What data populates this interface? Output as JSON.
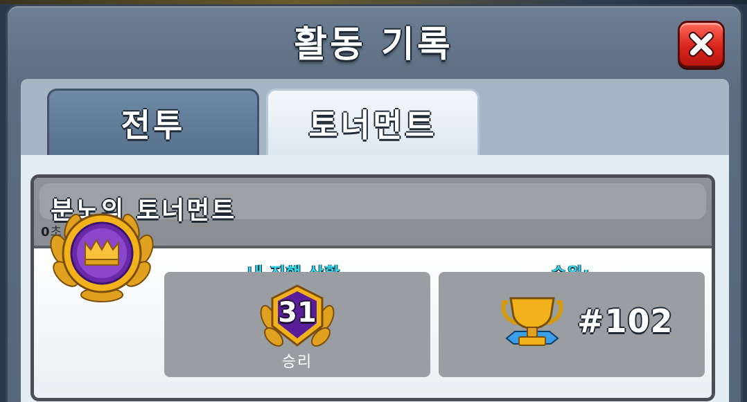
{
  "window": {
    "title": "활동 기록"
  },
  "tabs": [
    {
      "label": "전투",
      "active": false
    },
    {
      "label": "토너먼트",
      "active": true
    }
  ],
  "tournament": {
    "name": "분노의 토너먼트",
    "ended_count": "0",
    "ended_suffix": "초 전에 종료",
    "progress_label": "내 진행 상황",
    "wins_value": "31",
    "wins_label": "승리",
    "rank_label": "순위:",
    "rank_value": "#102"
  },
  "icons": {
    "close": "close-x-icon",
    "badge": "crown-laurel-badge-icon",
    "wins": "shield-laurel-icon",
    "rank": "trophy-icon"
  },
  "colors": {
    "accent_cyan": "#36d4e8",
    "close_red": "#d9261c",
    "gold": "#f2b21c",
    "purple": "#6a2aa8"
  }
}
